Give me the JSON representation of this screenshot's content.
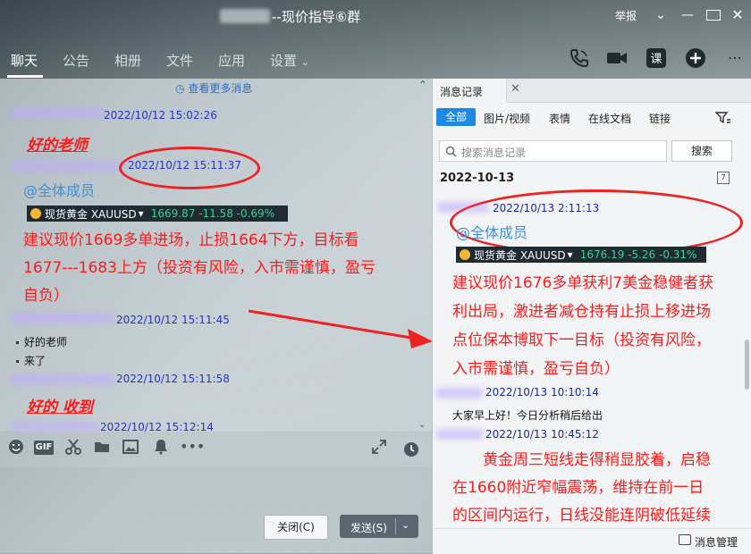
{
  "window": {
    "title": "--现价指导⑥群",
    "report": "举报"
  },
  "tabs": [
    "聊天",
    "公告",
    "相册",
    "文件",
    "应用",
    "设置"
  ],
  "chat": {
    "more_link": "查看更多消息",
    "messages": [
      {
        "time": "2022/10/12 15:02:26",
        "text": "好的老师"
      },
      {
        "time": "2022/10/12 15:11:37",
        "at": "@全体成员",
        "ticker": {
          "name": "现货黄金 XAUUSD",
          "price": "1669.87 -11.58 -0.69%"
        },
        "lines": [
          "建议现价1669多单进场，止损1664下方，目标看",
          "1677---1683上方（投资有风险，入市需谨慎，盈亏",
          "自负）"
        ]
      },
      {
        "time": "2022/10/12 15:11:45",
        "items": [
          "好的老师",
          "来了"
        ]
      },
      {
        "time": "2022/10/12 15:11:58",
        "text": "好的  收到"
      },
      {
        "time": "2022/10/12 15:12:14"
      }
    ]
  },
  "buttons": {
    "close": "关闭(C)",
    "send": "发送(S)"
  },
  "panel": {
    "tab": "消息记录",
    "filters": [
      "全部",
      "图片/视频",
      "表情",
      "在线文档",
      "链接"
    ],
    "search_placeholder": "搜索消息记录",
    "search_btn": "搜索",
    "date": "2022-10-13",
    "messages": [
      {
        "time": "2022/10/13 2:11:13",
        "at": "@全体成员",
        "ticker": {
          "name": "现货黄金 XAUUSD",
          "price": "1676.19 -5.26 -0.31%"
        },
        "lines": [
          "建议现价1676多单获利7美金稳健者获",
          "利出局，激进者减仓持有止损上移进场",
          "点位保本博取下一目标（投资有风险，",
          "入市需谨慎，盈亏自负）"
        ]
      },
      {
        "time": "2022/10/13 10:10:14",
        "text": "大家早上好！今日分析稍后给出"
      },
      {
        "time": "2022/10/13 10:45:12",
        "lines": [
          "　　黄金周三短线走得稍显胶着，启稳",
          "在1660附近窄幅震荡，维持在前一日",
          "的区间内运行，日线没能连阴破低延续"
        ]
      }
    ],
    "footer": "消息管理"
  },
  "colors": {
    "accent": "#1e88e5",
    "red": "#ff1a1a",
    "time_blue": "#2233cc",
    "ticker_green": "#3fd28e"
  }
}
